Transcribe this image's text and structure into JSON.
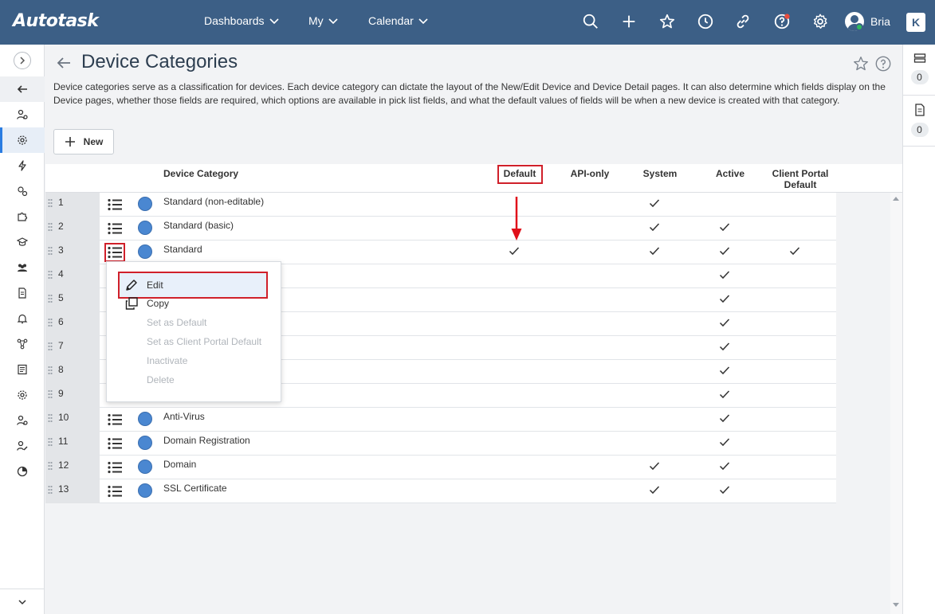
{
  "app": {
    "logo": "Autotask",
    "nav": [
      {
        "label": "Dashboards"
      },
      {
        "label": "My"
      },
      {
        "label": "Calendar"
      }
    ],
    "user_name": "Bria",
    "k_badge": "K"
  },
  "page": {
    "title": "Device Categories",
    "description": "Device categories serve as a classification for devices. Each device category can dictate the layout of the New/Edit Device and Device Detail pages. It can also determine which fields display on the Device pages, whether those fields are required, which options are available in pick list fields, and what the default values of fields will be when a new device is created with that category.",
    "new_button": "New"
  },
  "grid": {
    "columns": {
      "device_category": "Device Category",
      "default": "Default",
      "api_only": "API-only",
      "system": "System",
      "active": "Active",
      "client_portal_default": "Client Portal Default"
    },
    "rows": [
      {
        "num": "1",
        "name": "Standard (non-editable)",
        "default": false,
        "system": true,
        "active": false,
        "cpd": false
      },
      {
        "num": "2",
        "name": "Standard (basic)",
        "default": false,
        "system": true,
        "active": true,
        "cpd": false
      },
      {
        "num": "3",
        "name": "Standard",
        "default": true,
        "system": true,
        "active": true,
        "cpd": true
      },
      {
        "num": "4",
        "name": "",
        "default": false,
        "system": false,
        "active": true,
        "cpd": false
      },
      {
        "num": "5",
        "name": "",
        "default": false,
        "system": false,
        "active": true,
        "cpd": false
      },
      {
        "num": "6",
        "name": "",
        "default": false,
        "system": false,
        "active": true,
        "cpd": false
      },
      {
        "num": "7",
        "name": "",
        "default": false,
        "system": false,
        "active": true,
        "cpd": false
      },
      {
        "num": "8",
        "name": "",
        "default": false,
        "system": false,
        "active": true,
        "cpd": false
      },
      {
        "num": "9",
        "name": "",
        "default": false,
        "system": false,
        "active": true,
        "cpd": false
      },
      {
        "num": "10",
        "name": "Anti-Virus",
        "default": false,
        "system": false,
        "active": true,
        "cpd": false
      },
      {
        "num": "11",
        "name": "Domain Registration",
        "default": false,
        "system": false,
        "active": true,
        "cpd": false
      },
      {
        "num": "12",
        "name": "Domain",
        "default": false,
        "system": true,
        "active": true,
        "cpd": false
      },
      {
        "num": "13",
        "name": "SSL Certificate",
        "default": false,
        "system": true,
        "active": true,
        "cpd": false
      }
    ]
  },
  "context_menu": {
    "items": [
      {
        "label": "Edit",
        "enabled": true,
        "icon": "pencil-icon"
      },
      {
        "label": "Copy",
        "enabled": true,
        "icon": "copy-icon"
      },
      {
        "label": "Set as Default",
        "enabled": false
      },
      {
        "label": "Set as Client Portal Default",
        "enabled": false
      },
      {
        "label": "Inactivate",
        "enabled": false
      },
      {
        "label": "Delete",
        "enabled": false
      }
    ]
  },
  "right_panel": {
    "counts": [
      "0",
      "0"
    ]
  },
  "colors": {
    "topbar": "#3c5f86",
    "highlight_red": "#d0202a",
    "category_circle": "#4a87d1"
  }
}
